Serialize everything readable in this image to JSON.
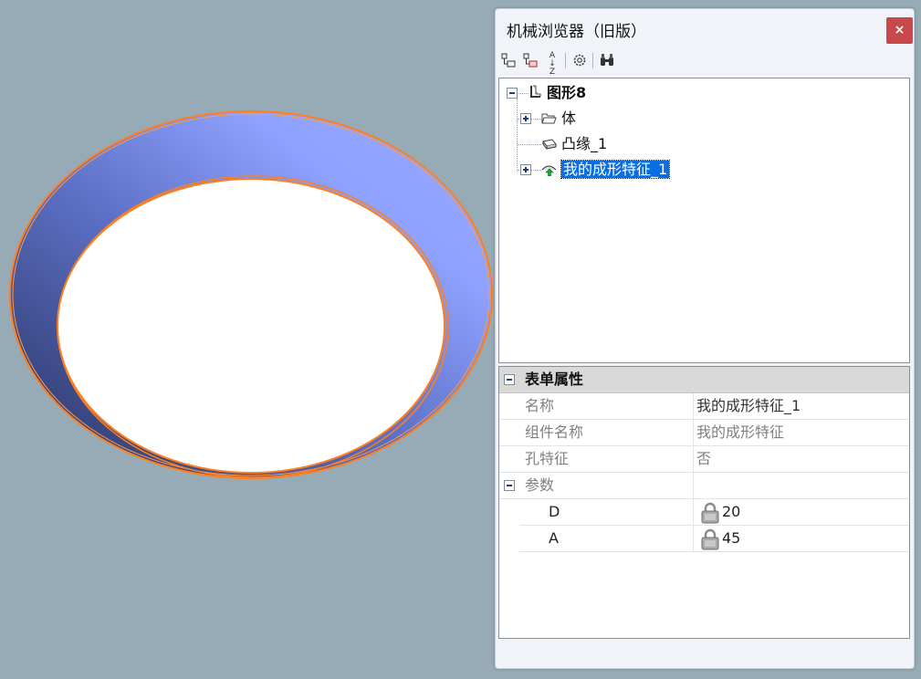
{
  "window": {
    "title": "机械浏览器（旧版）",
    "close_label": "×"
  },
  "toolbar": {
    "sort_label": "A↓Z"
  },
  "tree": {
    "root_label": "图形8",
    "items": [
      {
        "label": "体",
        "expandable": true
      },
      {
        "label": "凸缘_1",
        "expandable": false
      },
      {
        "label": "我的成形特征_1",
        "expandable": true,
        "selected": true
      }
    ]
  },
  "properties": {
    "group_label": "表单属性",
    "rows": [
      {
        "name": "名称",
        "value": "我的成形特征_1"
      },
      {
        "name": "组件名称",
        "value": "我的成形特征"
      },
      {
        "name": "孔特征",
        "value": "否"
      }
    ],
    "params_label": "参数",
    "params": [
      {
        "name": "D",
        "value": "20",
        "locked": true
      },
      {
        "name": "A",
        "value": "45",
        "locked": true
      }
    ]
  },
  "colors": {
    "viewport_bg": "#97abb6",
    "ring_light": "#8fa2ff",
    "ring_dark": "#27315e",
    "edge": "#ff7f1e",
    "selection": "#0a6ee0",
    "close_bg": "#c8484c"
  }
}
